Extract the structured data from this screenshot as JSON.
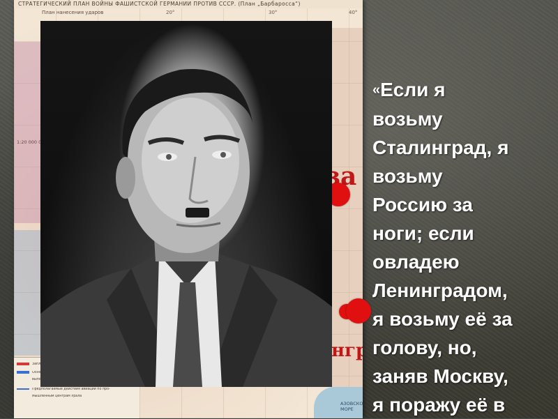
{
  "slide": {
    "map": {
      "title": "СТРАТЕГИЧЕСКИЙ ПЛАН ВОЙНЫ ФАШИСТСКОЙ ГЕРМАНИИ ПРОТИВ СССР. (План „Барбаросса“)",
      "subtitle": "План нанесения ударов",
      "coords": [
        "20°",
        "30°",
        "40°"
      ],
      "scale": "1:20 000 000",
      "city_top_fragment": "за",
      "city_bottom_fragment": "нград",
      "sea_label": "АЗОВСКОЕ МОРЕ",
      "legend": [
        "Запланированный рубеж продвижения войск",
        "Основные удары немецких войск по обеспечению",
        "выполнения ближайших задач группами армий",
        "Предполагаемые действия авиации по про-",
        "мышленным центрам Урала"
      ]
    },
    "quote": {
      "open_mark": "«",
      "text": "Если я\nвозьму\nСталинград, я\nвозьму\nРоссию за\nноги; если\nовладею\nЛенинградом,\nя возьму её за\nголову, но,\nзаняв Москву,\nя поражу её в"
    },
    "colors": {
      "marker": "#e01010",
      "city_label": "#c01818",
      "quote_text": "#ffffff"
    }
  }
}
